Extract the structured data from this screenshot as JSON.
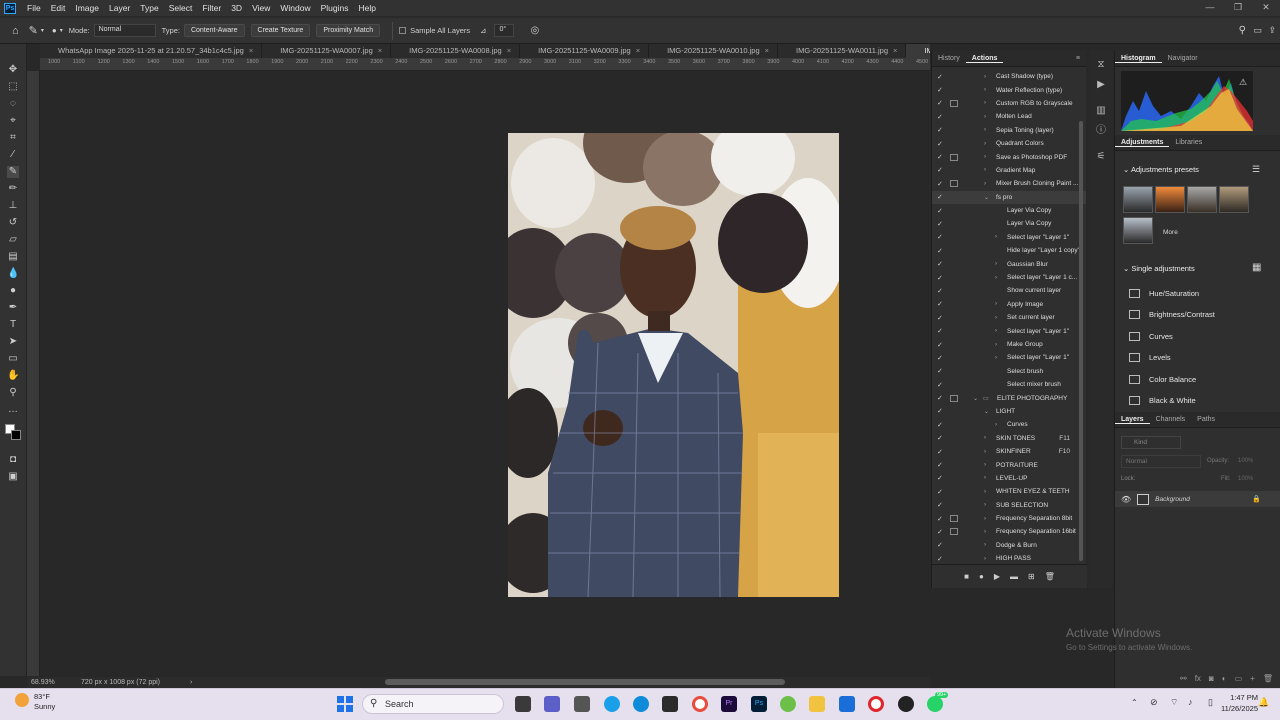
{
  "menu": [
    "File",
    "Edit",
    "Image",
    "Layer",
    "Type",
    "Select",
    "Filter",
    "3D",
    "View",
    "Window",
    "Plugins",
    "Help"
  ],
  "app_badge": "Ps",
  "options": {
    "mode_label": "Mode:",
    "mode_value": "Normal",
    "type_label": "Type:",
    "type_buttons": [
      "Content-Aware",
      "Create Texture",
      "Proximity Match"
    ],
    "sample_all_layers": "Sample All Layers",
    "angle_value": "0°"
  },
  "doc_tabs": [
    {
      "name": "WhatsApp Image 2025-11-25 at 21.20.57_34b1c4c5.jpg",
      "active": false
    },
    {
      "name": "IMG-20251125-WA0007.jpg",
      "active": false
    },
    {
      "name": "IMG-20251125-WA0008.jpg",
      "active": false
    },
    {
      "name": "IMG-20251125-WA0009.jpg",
      "active": false
    },
    {
      "name": "IMG-20251125-WA0010.jpg",
      "active": false
    },
    {
      "name": "IMG-20251125-WA0011.jpg",
      "active": false
    },
    {
      "name": "IMG-20251125-W",
      "active": true
    }
  ],
  "ruler_ticks": [
    "1000",
    "1100",
    "1200",
    "1300",
    "1400",
    "1500",
    "1600",
    "1700",
    "1800",
    "1900",
    "2000",
    "2100",
    "2200",
    "2300",
    "2400",
    "2500",
    "2600",
    "2700",
    "2800",
    "2900",
    "3000",
    "3100",
    "3200",
    "3300",
    "3400",
    "3500",
    "3600",
    "3700",
    "3800",
    "3900",
    "4000",
    "4100",
    "4200",
    "4300",
    "4400",
    "4500"
  ],
  "status": {
    "zoom": "68.93%",
    "doc_info": "720 px x 1008 px (72 ppi)"
  },
  "actions_panel": {
    "tabs": [
      "History",
      "Actions"
    ],
    "rows": [
      {
        "label": "Cast Shadow (type)",
        "indent": 1,
        "twisty": ">",
        "check": true,
        "dialog": false
      },
      {
        "label": "Water Reflection (type)",
        "indent": 1,
        "twisty": ">",
        "check": true,
        "dialog": false
      },
      {
        "label": "Custom RGB to Grayscale",
        "indent": 1,
        "twisty": ">",
        "check": true,
        "dialog": true
      },
      {
        "label": "Molten Lead",
        "indent": 1,
        "twisty": ">",
        "check": true,
        "dialog": false
      },
      {
        "label": "Sepia Toning (layer)",
        "indent": 1,
        "twisty": ">",
        "check": true,
        "dialog": false
      },
      {
        "label": "Quadrant Colors",
        "indent": 1,
        "twisty": ">",
        "check": true,
        "dialog": false
      },
      {
        "label": "Save as Photoshop PDF",
        "indent": 1,
        "twisty": ">",
        "check": true,
        "dialog": true
      },
      {
        "label": "Gradient Map",
        "indent": 1,
        "twisty": ">",
        "check": true,
        "dialog": false
      },
      {
        "label": "Mixer Brush Cloning Paint ...",
        "indent": 1,
        "twisty": ">",
        "check": true,
        "dialog": true
      },
      {
        "label": "fs pro",
        "indent": 1,
        "twisty": "v",
        "check": true,
        "dialog": false,
        "highlight": true
      },
      {
        "label": "Layer Via Copy",
        "indent": 2,
        "twisty": "",
        "check": true,
        "dialog": false
      },
      {
        "label": "Layer Via Copy",
        "indent": 2,
        "twisty": "",
        "check": true,
        "dialog": false
      },
      {
        "label": "Select layer \"Layer 1\"",
        "indent": 2,
        "twisty": ">",
        "check": true,
        "dialog": false
      },
      {
        "label": "Hide layer \"Layer 1 copy\"",
        "indent": 2,
        "twisty": "",
        "check": true,
        "dialog": false
      },
      {
        "label": "Gaussian Blur",
        "indent": 2,
        "twisty": ">",
        "check": true,
        "dialog": false
      },
      {
        "label": "Select layer \"Layer 1 c...",
        "indent": 2,
        "twisty": ">",
        "check": true,
        "dialog": false
      },
      {
        "label": "Show current layer",
        "indent": 2,
        "twisty": "",
        "check": true,
        "dialog": false
      },
      {
        "label": "Apply Image",
        "indent": 2,
        "twisty": ">",
        "check": true,
        "dialog": false
      },
      {
        "label": "Set current layer",
        "indent": 2,
        "twisty": ">",
        "check": true,
        "dialog": false
      },
      {
        "label": "Select layer \"Layer 1\"",
        "indent": 2,
        "twisty": ">",
        "check": true,
        "dialog": false
      },
      {
        "label": "Make Group",
        "indent": 2,
        "twisty": ">",
        "check": true,
        "dialog": false
      },
      {
        "label": "Select layer \"Layer 1\"",
        "indent": 2,
        "twisty": ">",
        "check": true,
        "dialog": false
      },
      {
        "label": "Select brush",
        "indent": 2,
        "twisty": "",
        "check": true,
        "dialog": false
      },
      {
        "label": "Select mixer brush",
        "indent": 2,
        "twisty": "",
        "check": true,
        "dialog": false
      },
      {
        "label": "ELITE PHOTOGRAPHY",
        "indent": 0,
        "twisty": "v",
        "check": true,
        "dialog": true,
        "folder": true
      },
      {
        "label": "LIGHT",
        "indent": 1,
        "twisty": "v",
        "check": true,
        "dialog": false
      },
      {
        "label": "Curves",
        "indent": 2,
        "twisty": ">",
        "check": true,
        "dialog": false
      },
      {
        "label": "SKIN TONES",
        "indent": 1,
        "twisty": ">",
        "check": true,
        "dialog": false,
        "fkey": "F11"
      },
      {
        "label": "SKINFINER",
        "indent": 1,
        "twisty": ">",
        "check": true,
        "dialog": false,
        "fkey": "F10"
      },
      {
        "label": "POTRAITURE",
        "indent": 1,
        "twisty": ">",
        "check": true,
        "dialog": false
      },
      {
        "label": "LEVEL-UP",
        "indent": 1,
        "twisty": ">",
        "check": true,
        "dialog": false
      },
      {
        "label": "WHITEN EYEZ & TEETH",
        "indent": 1,
        "twisty": ">",
        "check": true,
        "dialog": false
      },
      {
        "label": "SUB SELECTION",
        "indent": 1,
        "twisty": ">",
        "check": true,
        "dialog": false
      },
      {
        "label": "Frequency Separation 8bit",
        "indent": 1,
        "twisty": ">",
        "check": true,
        "dialog": true
      },
      {
        "label": "Frequency Separation 16bit",
        "indent": 1,
        "twisty": ">",
        "check": true,
        "dialog": true
      },
      {
        "label": "Dodge & Burn",
        "indent": 1,
        "twisty": ">",
        "check": true,
        "dialog": false
      },
      {
        "label": "HIGH PASS",
        "indent": 1,
        "twisty": ">",
        "check": true,
        "dialog": false
      }
    ],
    "footer_icons": [
      "stop-icon",
      "record-icon",
      "play-icon",
      "folder-icon",
      "new-icon",
      "trash-icon"
    ]
  },
  "right_panel": {
    "histogram_tabs": [
      "Histogram",
      "Navigator"
    ],
    "adj_tabs": [
      "Adjustments",
      "Libraries"
    ],
    "presets_title": "Adjustments presets",
    "more_label": "More",
    "single_title": "Single adjustments",
    "single_items": [
      "Hue/Saturation",
      "Brightness/Contrast",
      "Curves",
      "Levels",
      "Color Balance",
      "Black & White"
    ],
    "layer_tabs": [
      "Layers",
      "Channels",
      "Paths"
    ],
    "kind_placeholder": "Kind",
    "blend_mode": "Normal",
    "opacity_label": "Opacity:",
    "opacity_value": "100%",
    "lock_label": "Lock:",
    "fill_label": "Fill:",
    "fill_value": "100%",
    "layer_name": "Background"
  },
  "watermark": {
    "title": "Activate Windows",
    "subtitle": "Go to Settings to activate Windows."
  },
  "taskbar": {
    "weather_temp": "83°F",
    "weather_desc": "Sunny",
    "search_label": "Search",
    "time": "1:47 PM",
    "date": "11/26/2025",
    "badge": "99+"
  },
  "colors": {
    "accent": "#31a8ff",
    "panel": "#2f2f2f",
    "taskbar": "#e6e0ee"
  }
}
